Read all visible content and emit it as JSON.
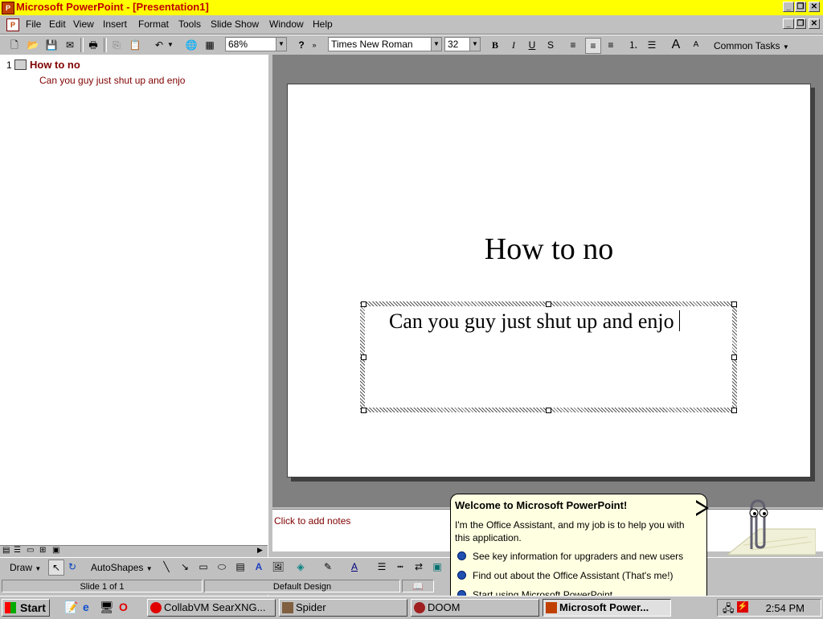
{
  "window": {
    "title": "Microsoft PowerPoint - [Presentation1]",
    "min": "_",
    "restore": "❐",
    "close": "✕"
  },
  "menu": {
    "items": [
      "File",
      "Edit",
      "View",
      "Insert",
      "Format",
      "Tools",
      "Slide Show",
      "Window",
      "Help"
    ]
  },
  "toolbar": {
    "zoom": "68%",
    "font": "Times New Roman",
    "size": "32",
    "bold": "B",
    "italic": "I",
    "underline": "U",
    "shadow": "S",
    "common_tasks": "Common Tasks"
  },
  "outline": {
    "slide_number": "1",
    "title": "How to no",
    "body": "Can you guy just shut up and enjo"
  },
  "slide": {
    "title": "How to no",
    "body": "Can you guy just shut up and enjo"
  },
  "notes": {
    "placeholder": "Click to add notes"
  },
  "drawbar": {
    "draw": "Draw",
    "autoshapes": "AutoShapes"
  },
  "status": {
    "slide": "Slide 1 of 1",
    "design": "Default Design"
  },
  "assistant": {
    "title": "Welcome to Microsoft PowerPoint!",
    "text": "I'm the Office Assistant, and my job is to help you with this application.",
    "options": [
      "See key information for upgraders and new users",
      "Find out about the Office Assistant (That's me!)",
      "Start using Microsoft PowerPoint"
    ]
  },
  "taskbar": {
    "start": "Start",
    "buttons": [
      "CollabVM SearXNG...",
      "Spider",
      "DOOM",
      "Microsoft Power..."
    ],
    "clock": "2:54 PM"
  },
  "colors": {
    "title_bar": "#ffff00",
    "title_text": "#c00000",
    "outline_text": "#800000"
  }
}
